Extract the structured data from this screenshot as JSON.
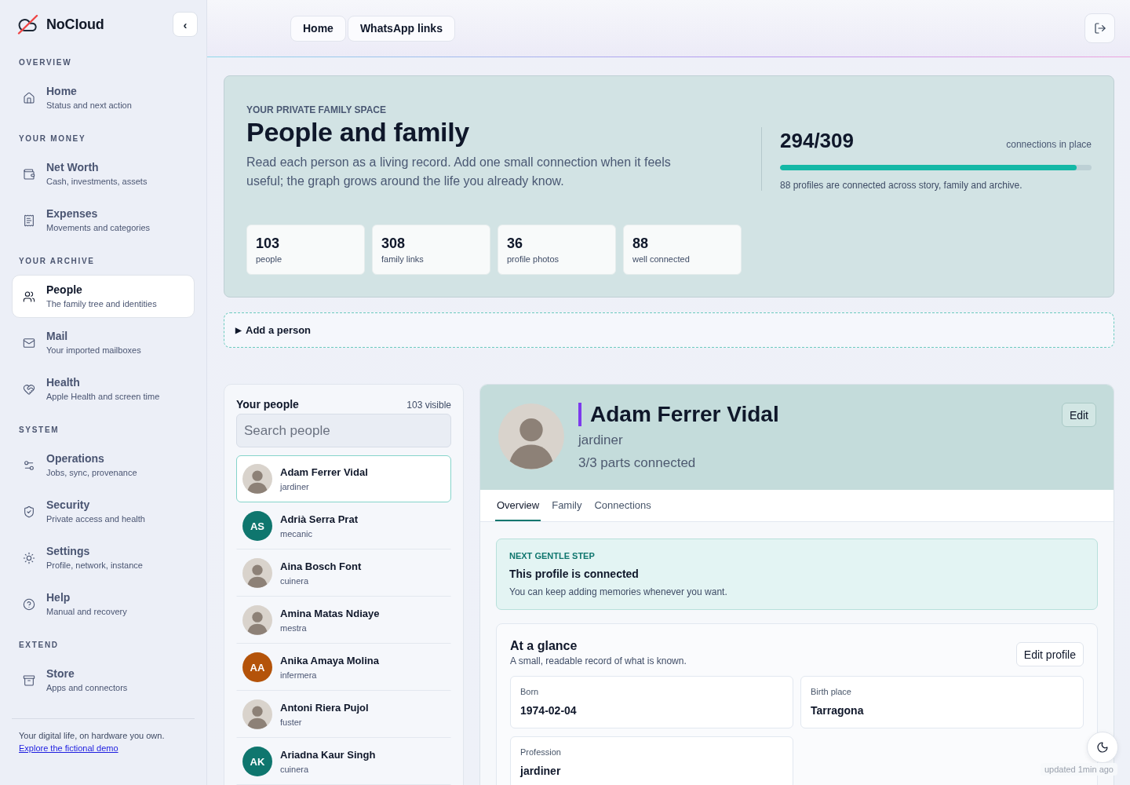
{
  "sidebar": {
    "brand": "NoCloud",
    "collapse_button": "‹",
    "sections": [
      {
        "title": "OVERVIEW",
        "items": [
          {
            "label": "Home",
            "description": "Status and next action",
            "selected": false
          }
        ]
      },
      {
        "title": "YOUR MONEY",
        "items": [
          {
            "label": "Net Worth",
            "description": "Cash, investments, assets",
            "selected": false
          },
          {
            "label": "Expenses",
            "description": "Movements and categories",
            "selected": false
          }
        ]
      },
      {
        "title": "YOUR ARCHIVE",
        "items": [
          {
            "label": "People",
            "description": "The family tree and identities",
            "selected": true
          },
          {
            "label": "Mail",
            "description": "Your imported mailboxes",
            "selected": false
          },
          {
            "label": "Health",
            "description": "Apple Health and screen time",
            "selected": false
          }
        ]
      },
      {
        "title": "SYSTEM",
        "items": [
          {
            "label": "Operations",
            "description": "Jobs, sync, provenance",
            "selected": false
          },
          {
            "label": "Security",
            "description": "Private access and health",
            "selected": false
          },
          {
            "label": "Settings",
            "description": "Profile, network, instance",
            "selected": false
          },
          {
            "label": "Help",
            "description": "Manual and recovery",
            "selected": false
          }
        ]
      },
      {
        "title": "EXTEND",
        "items": [
          {
            "label": "Store",
            "description": "Apps and connectors",
            "selected": false
          }
        ]
      }
    ],
    "footer": {
      "text": "Your digital life, on hardware you own.",
      "link": "Explore the fictional demo"
    }
  },
  "header": {
    "links": [
      "Home",
      "WhatsApp links"
    ]
  },
  "hero": {
    "eyebrow": "YOUR PRIVATE FAMILY SPACE",
    "title": "People and family",
    "description": "Read each person as a living record. Add one small connection when it feels useful; the graph grows around the life you already know.",
    "progress": {
      "reading": "294/309",
      "label": "connections in place",
      "level": 0.951,
      "note": "88 profiles are connected across story, family and archive."
    },
    "stats": [
      {
        "value": "103",
        "label": "people"
      },
      {
        "value": "308",
        "label": "family links"
      },
      {
        "value": "36",
        "label": "profile photos"
      },
      {
        "value": "88",
        "label": "well connected"
      }
    ]
  },
  "add_person": {
    "marker": "▶",
    "label": "Add a person",
    "expanded": false
  },
  "people_panel": {
    "title": "Your people",
    "count": "103 visible",
    "search": {
      "placeholder": "Search people"
    },
    "people": [
      {
        "name": "Adam Ferrer Vidal",
        "role": "jardiner",
        "selected": true,
        "avatar": {
          "kind": "photo"
        }
      },
      {
        "name": "Adrià Serra Prat",
        "role": "mecanic",
        "selected": false,
        "avatar": {
          "kind": "initials",
          "initials": "AS",
          "color": "#0f766e"
        }
      },
      {
        "name": "Aina Bosch Font",
        "role": "cuinera",
        "selected": false,
        "avatar": {
          "kind": "photo"
        }
      },
      {
        "name": "Amina Matas Ndiaye",
        "role": "mestra",
        "selected": false,
        "avatar": {
          "kind": "photo"
        }
      },
      {
        "name": "Anika Amaya Molina",
        "role": "infermera",
        "selected": false,
        "avatar": {
          "kind": "initials",
          "initials": "AA",
          "color": "#b45309"
        }
      },
      {
        "name": "Antoni Riera Pujol",
        "role": "fuster",
        "selected": false,
        "avatar": {
          "kind": "photo"
        }
      },
      {
        "name": "Ariadna Kaur Singh",
        "role": "cuinera",
        "selected": false,
        "avatar": {
          "kind": "initials",
          "initials": "AK",
          "color": "#0f766e"
        }
      }
    ]
  },
  "profile": {
    "avatar": {
      "kind": "photo"
    },
    "name": "Adam Ferrer Vidal",
    "role": "jardiner",
    "parts": "3/3 parts connected",
    "edit_button": "Edit",
    "tabs": [
      {
        "label": "Overview",
        "selected": true
      },
      {
        "label": "Family",
        "selected": false
      },
      {
        "label": "Connections",
        "selected": false
      }
    ],
    "next_step": {
      "eyebrow": "NEXT GENTLE STEP",
      "title": "This profile is connected",
      "text": "You can keep adding memories whenever you want."
    },
    "glance": {
      "title": "At a glance",
      "subtitle": "A small, readable record of what is known.",
      "edit_button": "Edit profile",
      "fields": [
        {
          "label": "Born",
          "value": "1974-02-04"
        },
        {
          "label": "Birth place",
          "value": "Tarragona"
        },
        {
          "label": "Profession",
          "value": "jardiner"
        }
      ]
    }
  },
  "status": {
    "updated": "updated 1min ago"
  }
}
